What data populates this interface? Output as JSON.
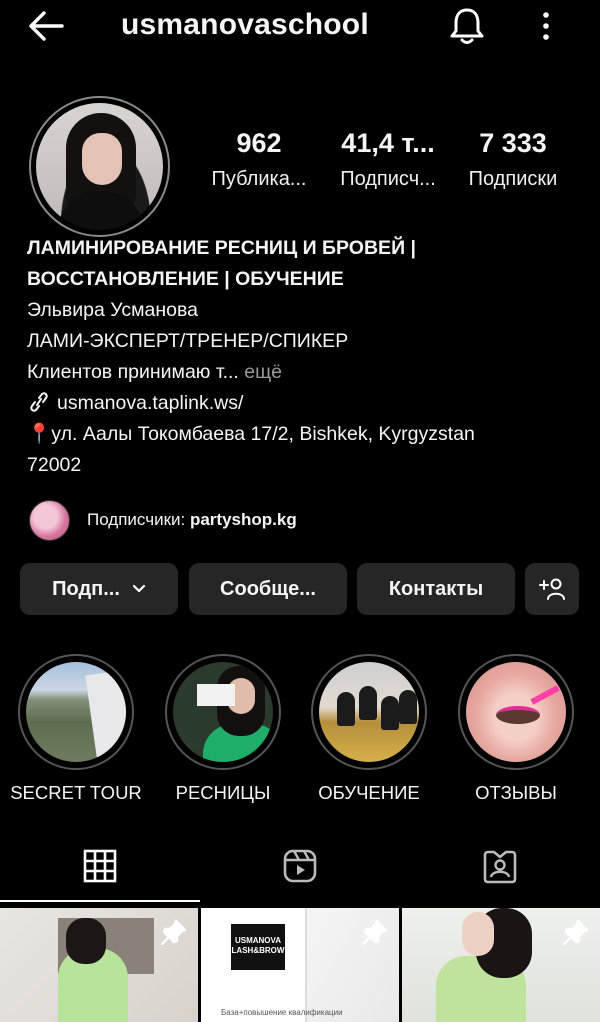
{
  "topbar": {
    "username": "usmanovaschool",
    "back_icon": "arrow-left-icon",
    "bell_icon": "bell-icon",
    "more_icon": "more-vertical-icon"
  },
  "stats": [
    {
      "value": "962",
      "label": "Публика..."
    },
    {
      "value": "41,4 т...",
      "label": "Подписч..."
    },
    {
      "value": "7 333",
      "label": "Подписки"
    }
  ],
  "bio": {
    "name_line1": "ЛАМИНИРОВАНИЕ РЕСНИЦ И БРОВЕЙ |",
    "name_line2": "ВОССТАНОВЛЕНИЕ | ОБУЧЕНИЕ",
    "full_name": "Эльвира Усманова",
    "role": "ЛАМИ-ЭКСПЕРТ/ТРЕНЕР/СПИКЕР",
    "text": "Клиентов принимаю т...",
    "more": "ещё",
    "link": "usmanova.taplink.ws/",
    "pin": "📍",
    "address_line1": "ул. Аалы Токомбаева 17/2, Bishkek, Kyrgyzstan",
    "address_line2": "72002"
  },
  "followed_by": {
    "prefix": "Подписчики: ",
    "account": "partyshop.kg"
  },
  "buttons": {
    "following": "Подп...",
    "message": "Сообще...",
    "contacts": "Контакты",
    "add_user_icon": "add-user-icon"
  },
  "highlights": [
    {
      "label": "SECRET TOUR"
    },
    {
      "label": "РЕСНИЦЫ"
    },
    {
      "label": "ОБУЧЕНИЕ"
    },
    {
      "label": "ОТЗЫВЫ"
    }
  ],
  "tabs": [
    "grid-icon",
    "reels-icon",
    "tagged-icon"
  ],
  "posts": {
    "logo_text": "USMANOVA LASH&BROW",
    "caption": "База+повышение квалификации"
  },
  "colors": {
    "background": "#000000",
    "button_bg": "#262626",
    "text": "#f5f5f5",
    "muted": "#9a9a9a"
  }
}
